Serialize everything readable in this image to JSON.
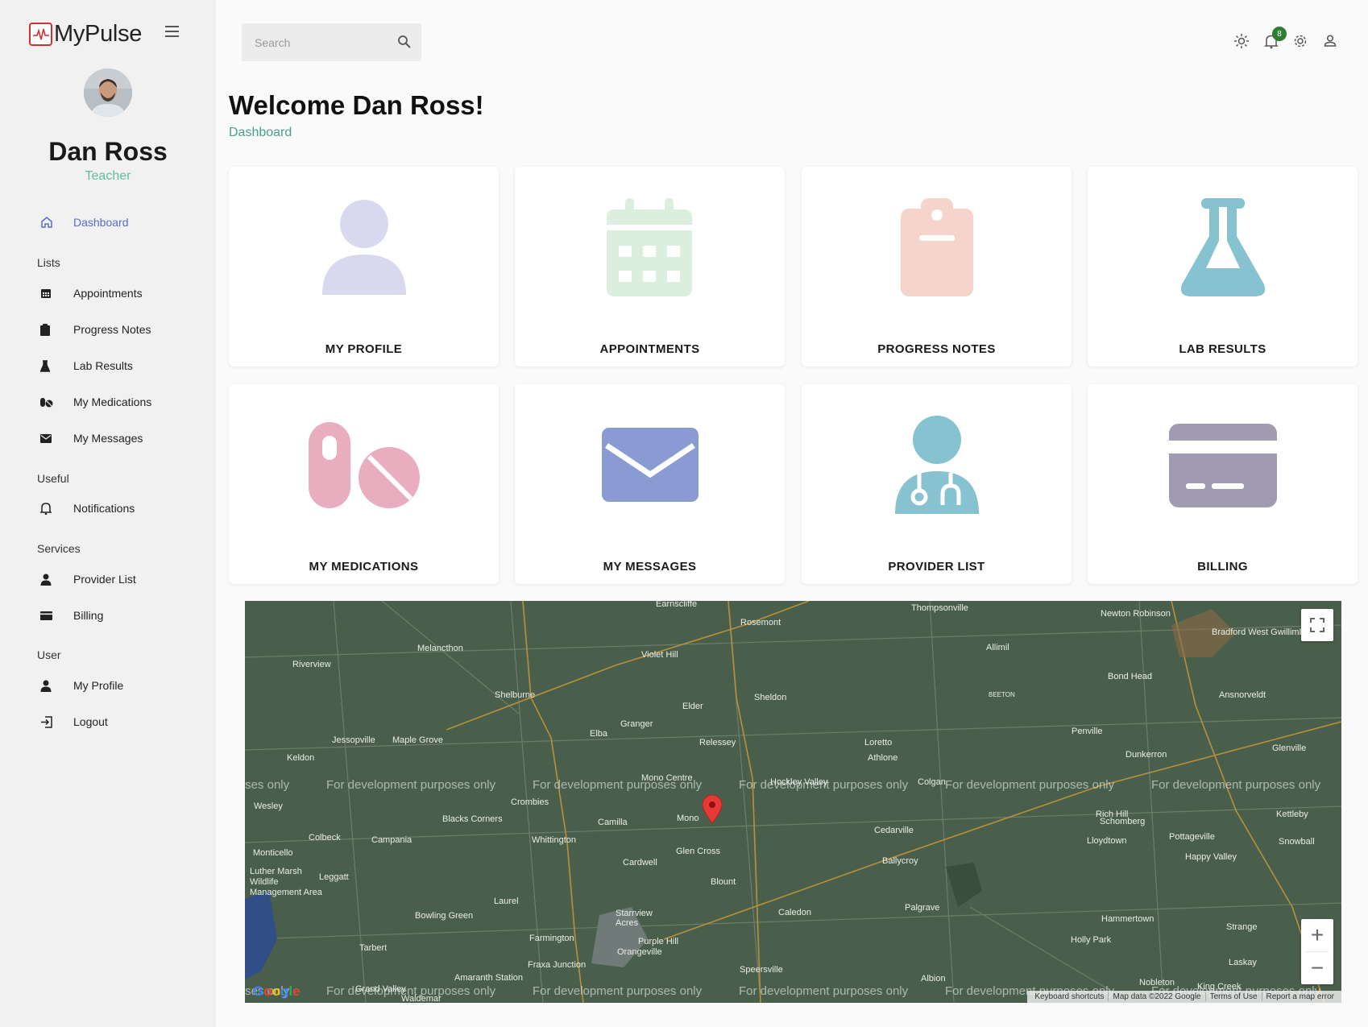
{
  "brand": {
    "name": "MyPulse"
  },
  "user": {
    "name": "Dan Ross",
    "role": "Teacher"
  },
  "nav": {
    "dashboard": "Dashboard",
    "lists_header": "Lists",
    "appointments": "Appointments",
    "progress_notes": "Progress Notes",
    "lab_results": "Lab Results",
    "my_medications": "My Medications",
    "my_messages": "My Messages",
    "useful_header": "Useful",
    "notifications": "Notifications",
    "services_header": "Services",
    "provider_list": "Provider List",
    "billing": "Billing",
    "user_header": "User",
    "my_profile": "My Profile",
    "logout": "Logout"
  },
  "topbar": {
    "search_placeholder": "Search",
    "notification_count": "8"
  },
  "page": {
    "title": "Welcome Dan Ross!",
    "breadcrumb": "Dashboard"
  },
  "cards": {
    "profile": "MY PROFILE",
    "appointments": "APPOINTMENTS",
    "progress_notes": "PROGRESS NOTES",
    "lab_results": "LAB RESULTS",
    "medications": "MY MEDICATIONS",
    "messages": "MY MESSAGES",
    "providers": "PROVIDER LIST",
    "billing": "BILLING"
  },
  "colors": {
    "active_nav": "#5a6acf",
    "role_text": "#5fbf9c",
    "breadcrumb": "#4a9d8f",
    "badge": "#2e7d32",
    "profile_icon": "#d8d9ee",
    "calendar_icon": "#dcefdf",
    "notes_icon": "#f4d4cb",
    "lab_icon": "#86c2cf",
    "pills_icon": "#e8aebf",
    "mail_icon": "#8a9ad2",
    "provider_icon": "#86c2cf",
    "billing_icon": "#a19bb2",
    "map_bg": "#4a5f4b"
  },
  "map": {
    "watermark": "For development purposes only",
    "places": [
      "Earnscliffe",
      "Rosemont",
      "Thompsonville",
      "Newton Robinson",
      "Bradford West Gwillimbury",
      "Melancthon",
      "Riverview",
      "Violet Hill",
      "Allimil",
      "Bond Head",
      "Shelburne",
      "Sheldon",
      "Elder",
      "BEETON",
      "Ansnorveldt",
      "Granger",
      "Elba",
      "Penville",
      "Jessopville",
      "Maple Grove",
      "Relessey",
      "Loretto",
      "Glenville",
      "Keldon",
      "Athlone",
      "Dunkerron",
      "Mono Centre",
      "Hockley Valley",
      "Colgan",
      "Crombies",
      "Wesley",
      "Blacks Corners",
      "Camilla",
      "Mono",
      "Rich Hill",
      "Schomberg",
      "Kettleby",
      "Colbeck",
      "Campania",
      "Whittington",
      "Cedarville",
      "Lloydtown",
      "Pottageville",
      "Snowball",
      "Monticello",
      "Glen Cross",
      "Ballycroy",
      "Happy Valley",
      "Luther Marsh Wildlife Management Area",
      "Leggatt",
      "Cardwell",
      "Blount",
      "Laurel",
      "Palgrave",
      "Bowling Green",
      "Caledon",
      "Starrview Acres",
      "Hammertown",
      "Strange",
      "Farmington",
      "Purple Hill",
      "Orangeville",
      "Holly Park",
      "Tarbert",
      "Fraxa Junction",
      "Speersville",
      "Laskay",
      "Amaranth Station",
      "Albion",
      "Nobleton",
      "King Creek",
      "Grand Valley",
      "Waldemar"
    ],
    "attribution": [
      "Keyboard shortcuts",
      "Map data ©2022 Google",
      "Terms of Use",
      "Report a map error"
    ],
    "logo": "Google"
  }
}
